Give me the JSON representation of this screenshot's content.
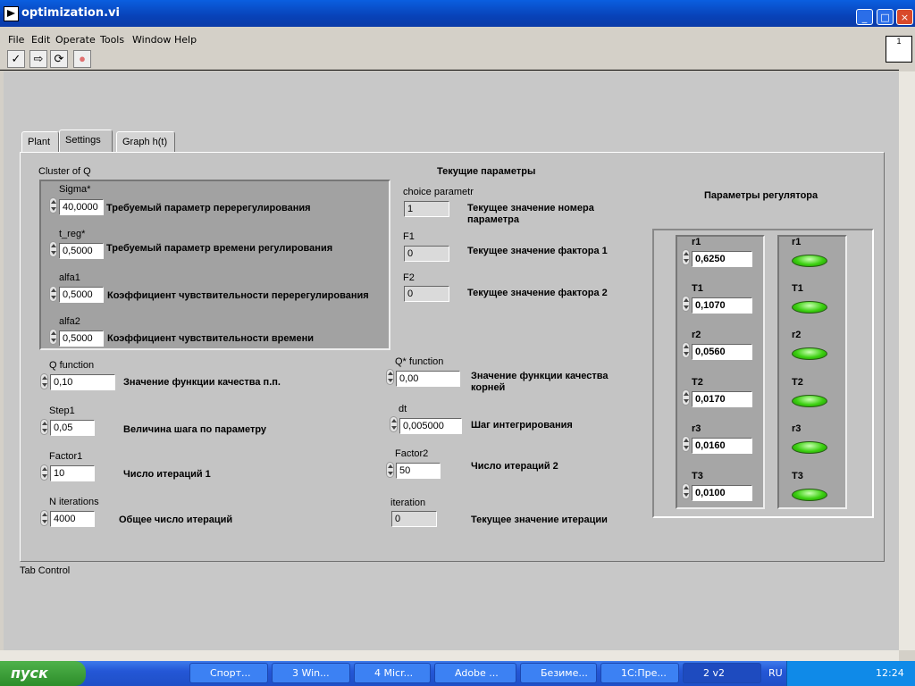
{
  "window": {
    "title": "optimization.vi",
    "minimize": "_",
    "maximize": "□",
    "close": "×"
  },
  "menu": [
    "File",
    "Edit",
    "Operate",
    "Tools",
    "Window",
    "Help"
  ],
  "toolbar": {
    "run": "✓",
    "run_continuous": "⇨",
    "abort": "●",
    "vi_icon_num": "1"
  },
  "tabs": [
    "Plant",
    "Settings",
    "Graph h(t)"
  ],
  "tab_control_label": "Tab Control",
  "cluster": {
    "title": "Cluster of Q",
    "items": [
      {
        "caption": "Sigma*",
        "value": "40,0000",
        "label": "Требуемый параметр перерегулирования"
      },
      {
        "caption": "t_reg*",
        "value": "0,5000",
        "label": "Требуемый параметр времени регулирования"
      },
      {
        "caption": "alfa1",
        "value": "0,5000",
        "label": "Коэффициент чувствительности перерегулирования"
      },
      {
        "caption": "alfa2",
        "value": "0,5000",
        "label": "Коэффициент чувствительности времени"
      }
    ]
  },
  "left_controls": [
    {
      "caption": "Q function",
      "value": "0,10",
      "label": "Значение функции качества п.п."
    },
    {
      "caption": "Step1",
      "value": "0,05",
      "label": "Величина шага по параметру"
    },
    {
      "caption": "Factor1",
      "value": "10",
      "label": "Число итераций 1"
    },
    {
      "caption": "N iterations",
      "value": "4000",
      "label": "Общее число итераций"
    }
  ],
  "current_params": {
    "title": "Текущие параметры",
    "items": [
      {
        "caption": "choice parametr",
        "value": "1",
        "label": "Текущее значение номера параметра"
      },
      {
        "caption": "F1",
        "value": "0",
        "label": "Текущее значение фактора 1"
      },
      {
        "caption": "F2",
        "value": "0",
        "label": "Текущее значение фактора 2"
      }
    ]
  },
  "mid_controls": [
    {
      "caption": "Q* function",
      "value": "0,00",
      "label": "Значение функции качества корней"
    },
    {
      "caption": "dt",
      "value": "0,005000",
      "label": "Шаг интегрирования"
    },
    {
      "caption": "Factor2",
      "value": "50",
      "label": "Число итераций 2"
    },
    {
      "caption": "iteration",
      "value": "0",
      "label": "Текущее значение итерации"
    }
  ],
  "regulator": {
    "title": "Параметры регулятора",
    "params": [
      {
        "caption": "r1",
        "value": "0,6250"
      },
      {
        "caption": "T1",
        "value": "0,1070"
      },
      {
        "caption": "r2",
        "value": "0,0560"
      },
      {
        "caption": "T2",
        "value": "0,0170"
      },
      {
        "caption": "r3",
        "value": "0,0160"
      },
      {
        "caption": "T3",
        "value": "0,0100"
      }
    ],
    "leds": [
      "r1",
      "T1",
      "r2",
      "T2",
      "r3",
      "T3"
    ]
  },
  "taskbar": {
    "start": "пуск",
    "tasks": [
      "Спорт...",
      "3 Win...",
      "4 Micr...",
      "Adobe ...",
      "Безиме...",
      "1С:Пре...",
      "2 v2"
    ],
    "lang": "RU",
    "clock": "12:24"
  },
  "colors": {
    "titlebar": "#0842b8",
    "panel": "#c8c8c8",
    "led_on": "#3bd010",
    "taskbar": "#2457d6",
    "start": "#2d8d2a"
  }
}
